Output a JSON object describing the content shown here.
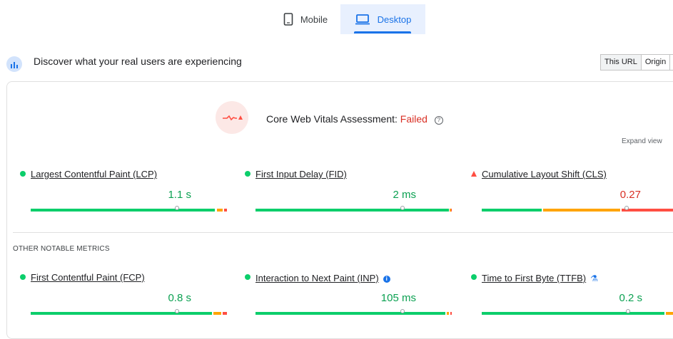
{
  "tabs": [
    {
      "label": "Mobile",
      "icon": "smartphone-icon",
      "active": false
    },
    {
      "label": "Desktop",
      "icon": "laptop-icon",
      "active": true
    }
  ],
  "header": {
    "title": "Discover what your real users are experiencing",
    "icon": "crux-logo-icon",
    "toggle": [
      "This URL",
      "Origin"
    ]
  },
  "assessment": {
    "label": "Core Web Vitals Assessment:",
    "status": "Failed",
    "expand": "Expand view"
  },
  "core_metrics": [
    {
      "name": "Largest Contentful Paint (LCP)",
      "value": "1.1 s",
      "rating": "good"
    },
    {
      "name": "First Input Delay (FID)",
      "value": "2 ms",
      "rating": "good"
    },
    {
      "name": "Cumulative Layout Shift (CLS)",
      "value": "0.27",
      "rating": "poor"
    }
  ],
  "other_label": "OTHER NOTABLE METRICS",
  "other_metrics": [
    {
      "name": "First Contentful Paint (FCP)",
      "value": "0.8 s",
      "rating": "good"
    },
    {
      "name": "Interaction to Next Paint (INP)",
      "value": "105 ms",
      "rating": "good",
      "badge": "info-icon"
    },
    {
      "name": "Time to First Byte (TTFB)",
      "value": "0.2 s",
      "rating": "good",
      "badge": "flask-icon"
    }
  ],
  "colors": {
    "good": "#0cce6b",
    "needs_improvement": "#ffa400",
    "poor": "#ff4e42",
    "accent": "#1a73e8",
    "failed_text": "#d93025"
  }
}
